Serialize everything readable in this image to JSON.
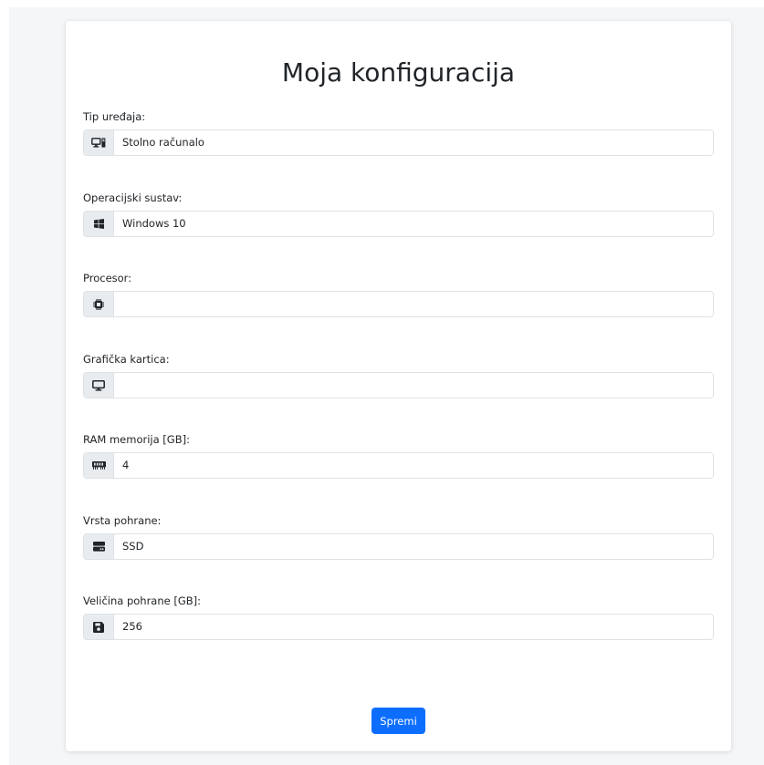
{
  "page": {
    "title": "Moja konfiguracija"
  },
  "fields": {
    "device_type": {
      "label": "Tip uređaja:",
      "value": "Stolno računalo",
      "icon": "pc-display-icon"
    },
    "operating_system": {
      "label": "Operacijski sustav:",
      "value": "Windows 10",
      "icon": "windows-icon"
    },
    "processor": {
      "label": "Procesor:",
      "value": "",
      "icon": "cpu-icon"
    },
    "graphics_card": {
      "label": "Grafička kartica:",
      "value": "",
      "icon": "display-icon"
    },
    "ram": {
      "label": "RAM memorija [GB]:",
      "value": "4",
      "icon": "memory-icon"
    },
    "storage_type": {
      "label": "Vrsta pohrane:",
      "value": "SSD",
      "icon": "hdd-icon"
    },
    "storage_size": {
      "label": "Veličina pohrane [GB]:",
      "value": "256",
      "icon": "floppy-icon"
    }
  },
  "actions": {
    "save_label": "Spremi"
  },
  "colors": {
    "primary": "#0d6efd",
    "addon_bg": "#e9ecef",
    "border": "#dee2e6",
    "page_bg": "#f5f6f8"
  }
}
